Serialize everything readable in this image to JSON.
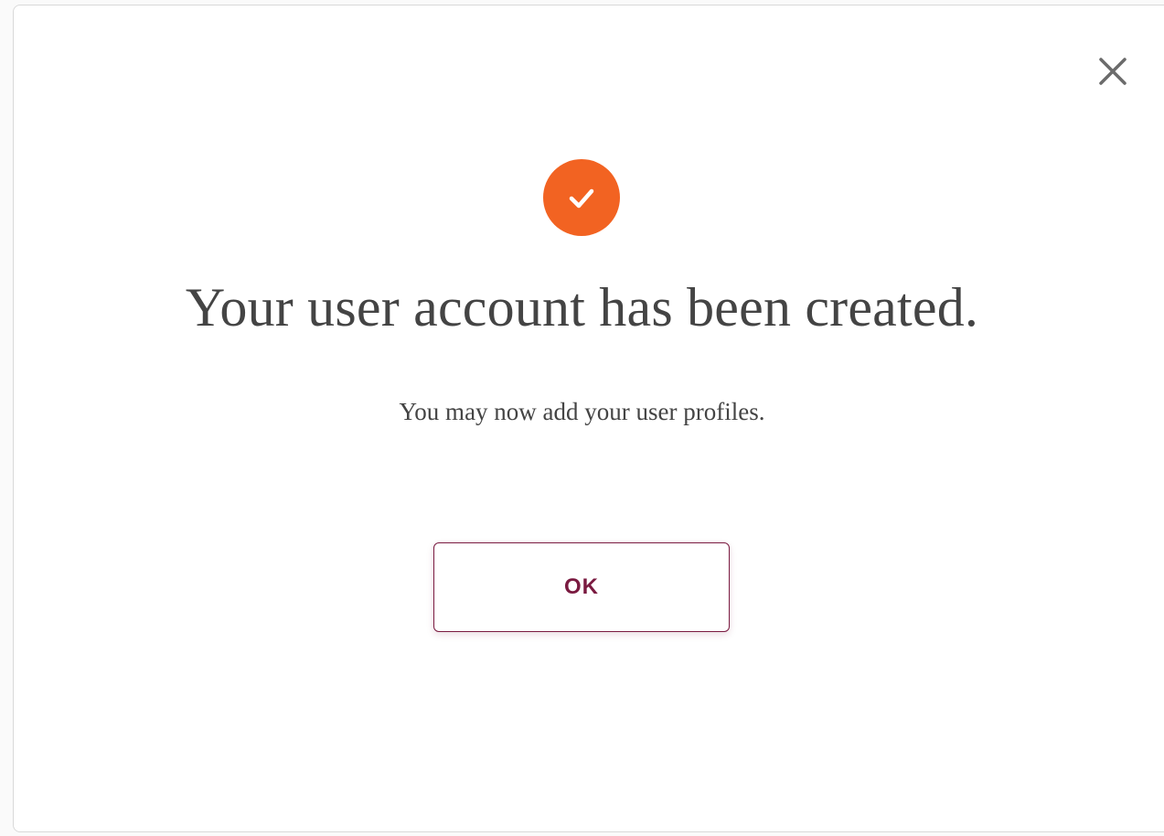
{
  "colors": {
    "success_circle": "#f26322",
    "success_check": "#ffffff",
    "button_border": "#7a1a40",
    "button_text": "#7a1a40",
    "close_icon": "#6b6b6b",
    "text": "#444444"
  },
  "icons": {
    "close": "close-icon",
    "success": "checkmark-icon"
  },
  "dialog": {
    "title": "Your user account has been created.",
    "message": "You may now add your user profiles.",
    "ok_label": "OK"
  }
}
